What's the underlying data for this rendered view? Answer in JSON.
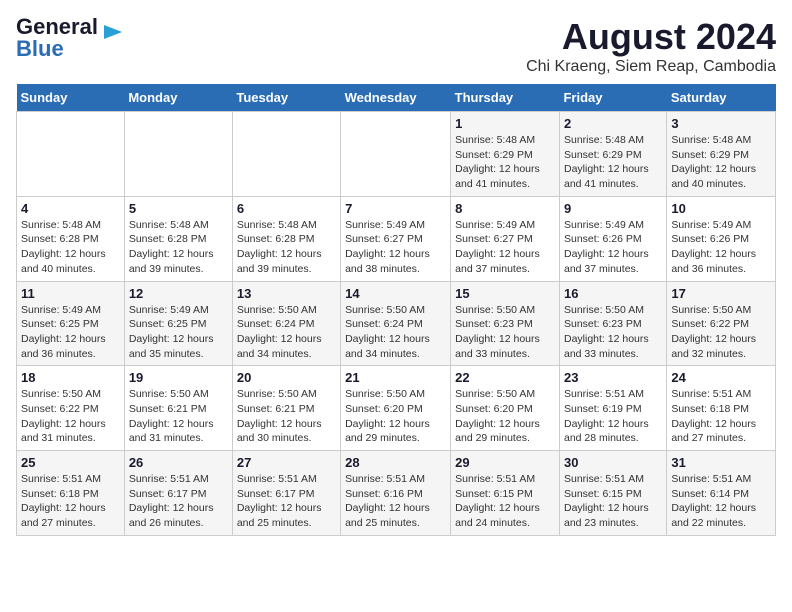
{
  "logo": {
    "line1": "General",
    "line2": "Blue"
  },
  "title": "August 2024",
  "subtitle": "Chi Kraeng, Siem Reap, Cambodia",
  "headers": [
    "Sunday",
    "Monday",
    "Tuesday",
    "Wednesday",
    "Thursday",
    "Friday",
    "Saturday"
  ],
  "weeks": [
    [
      {
        "day": "",
        "info": ""
      },
      {
        "day": "",
        "info": ""
      },
      {
        "day": "",
        "info": ""
      },
      {
        "day": "",
        "info": ""
      },
      {
        "day": "1",
        "info": "Sunrise: 5:48 AM\nSunset: 6:29 PM\nDaylight: 12 hours\nand 41 minutes."
      },
      {
        "day": "2",
        "info": "Sunrise: 5:48 AM\nSunset: 6:29 PM\nDaylight: 12 hours\nand 41 minutes."
      },
      {
        "day": "3",
        "info": "Sunrise: 5:48 AM\nSunset: 6:29 PM\nDaylight: 12 hours\nand 40 minutes."
      }
    ],
    [
      {
        "day": "4",
        "info": "Sunrise: 5:48 AM\nSunset: 6:28 PM\nDaylight: 12 hours\nand 40 minutes."
      },
      {
        "day": "5",
        "info": "Sunrise: 5:48 AM\nSunset: 6:28 PM\nDaylight: 12 hours\nand 39 minutes."
      },
      {
        "day": "6",
        "info": "Sunrise: 5:48 AM\nSunset: 6:28 PM\nDaylight: 12 hours\nand 39 minutes."
      },
      {
        "day": "7",
        "info": "Sunrise: 5:49 AM\nSunset: 6:27 PM\nDaylight: 12 hours\nand 38 minutes."
      },
      {
        "day": "8",
        "info": "Sunrise: 5:49 AM\nSunset: 6:27 PM\nDaylight: 12 hours\nand 37 minutes."
      },
      {
        "day": "9",
        "info": "Sunrise: 5:49 AM\nSunset: 6:26 PM\nDaylight: 12 hours\nand 37 minutes."
      },
      {
        "day": "10",
        "info": "Sunrise: 5:49 AM\nSunset: 6:26 PM\nDaylight: 12 hours\nand 36 minutes."
      }
    ],
    [
      {
        "day": "11",
        "info": "Sunrise: 5:49 AM\nSunset: 6:25 PM\nDaylight: 12 hours\nand 36 minutes."
      },
      {
        "day": "12",
        "info": "Sunrise: 5:49 AM\nSunset: 6:25 PM\nDaylight: 12 hours\nand 35 minutes."
      },
      {
        "day": "13",
        "info": "Sunrise: 5:50 AM\nSunset: 6:24 PM\nDaylight: 12 hours\nand 34 minutes."
      },
      {
        "day": "14",
        "info": "Sunrise: 5:50 AM\nSunset: 6:24 PM\nDaylight: 12 hours\nand 34 minutes."
      },
      {
        "day": "15",
        "info": "Sunrise: 5:50 AM\nSunset: 6:23 PM\nDaylight: 12 hours\nand 33 minutes."
      },
      {
        "day": "16",
        "info": "Sunrise: 5:50 AM\nSunset: 6:23 PM\nDaylight: 12 hours\nand 33 minutes."
      },
      {
        "day": "17",
        "info": "Sunrise: 5:50 AM\nSunset: 6:22 PM\nDaylight: 12 hours\nand 32 minutes."
      }
    ],
    [
      {
        "day": "18",
        "info": "Sunrise: 5:50 AM\nSunset: 6:22 PM\nDaylight: 12 hours\nand 31 minutes."
      },
      {
        "day": "19",
        "info": "Sunrise: 5:50 AM\nSunset: 6:21 PM\nDaylight: 12 hours\nand 31 minutes."
      },
      {
        "day": "20",
        "info": "Sunrise: 5:50 AM\nSunset: 6:21 PM\nDaylight: 12 hours\nand 30 minutes."
      },
      {
        "day": "21",
        "info": "Sunrise: 5:50 AM\nSunset: 6:20 PM\nDaylight: 12 hours\nand 29 minutes."
      },
      {
        "day": "22",
        "info": "Sunrise: 5:50 AM\nSunset: 6:20 PM\nDaylight: 12 hours\nand 29 minutes."
      },
      {
        "day": "23",
        "info": "Sunrise: 5:51 AM\nSunset: 6:19 PM\nDaylight: 12 hours\nand 28 minutes."
      },
      {
        "day": "24",
        "info": "Sunrise: 5:51 AM\nSunset: 6:18 PM\nDaylight: 12 hours\nand 27 minutes."
      }
    ],
    [
      {
        "day": "25",
        "info": "Sunrise: 5:51 AM\nSunset: 6:18 PM\nDaylight: 12 hours\nand 27 minutes."
      },
      {
        "day": "26",
        "info": "Sunrise: 5:51 AM\nSunset: 6:17 PM\nDaylight: 12 hours\nand 26 minutes."
      },
      {
        "day": "27",
        "info": "Sunrise: 5:51 AM\nSunset: 6:17 PM\nDaylight: 12 hours\nand 25 minutes."
      },
      {
        "day": "28",
        "info": "Sunrise: 5:51 AM\nSunset: 6:16 PM\nDaylight: 12 hours\nand 25 minutes."
      },
      {
        "day": "29",
        "info": "Sunrise: 5:51 AM\nSunset: 6:15 PM\nDaylight: 12 hours\nand 24 minutes."
      },
      {
        "day": "30",
        "info": "Sunrise: 5:51 AM\nSunset: 6:15 PM\nDaylight: 12 hours\nand 23 minutes."
      },
      {
        "day": "31",
        "info": "Sunrise: 5:51 AM\nSunset: 6:14 PM\nDaylight: 12 hours\nand 22 minutes."
      }
    ]
  ]
}
